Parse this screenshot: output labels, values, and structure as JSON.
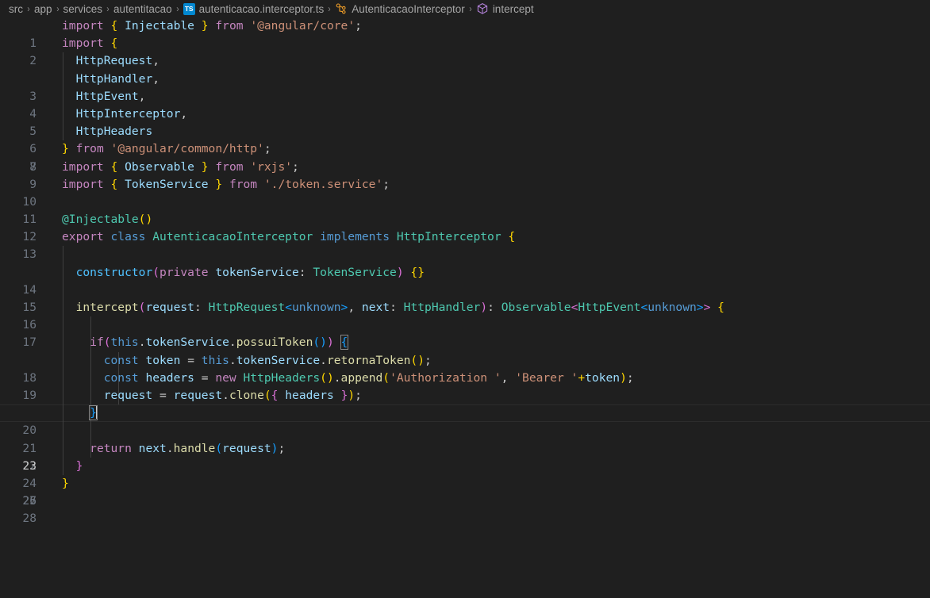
{
  "window": {
    "background": "#1f1f1f",
    "title": "autenticacao.interceptor.ts"
  },
  "breadcrumb": {
    "items": [
      {
        "label": "src",
        "icon": null,
        "sep": "›"
      },
      {
        "label": "app",
        "icon": null,
        "sep": "›"
      },
      {
        "label": "services",
        "icon": null,
        "sep": "›"
      },
      {
        "label": "autentitacao",
        "icon": null,
        "sep": "›"
      },
      {
        "label": "autenticacao.interceptor.ts",
        "icon": "ts-file-icon",
        "icon_text": "TS",
        "sep": "›"
      },
      {
        "label": "AutenticacaoInterceptor",
        "icon": "class-symbol-icon",
        "sep": "›"
      },
      {
        "label": "intercept",
        "icon": "method-symbol-icon",
        "sep": null
      }
    ],
    "separator": "›",
    "ts_badge_text": "TS",
    "ts_badge_color": "#0288d1",
    "class_icon_color": "#ee9d28",
    "method_icon_color": "#b180d7"
  },
  "colors": {
    "editor_background": "#1f1f1f",
    "line_number": "#6e7681",
    "active_line_number": "#cccccc",
    "keyword": "#c586c0",
    "keyword_blue": "#569cd6",
    "identifier": "#9cdcfe",
    "type": "#4ec9b0",
    "function": "#dcdcaa",
    "string": "#ce9178",
    "bracket_level1": "#ffd700",
    "bracket_level2": "#da70d6",
    "bracket_level3": "#179fff",
    "indent_guide": "#404040",
    "active_line_border": "#2c2c2c"
  },
  "editor": {
    "active_line": 23,
    "total_lines": 28,
    "language": "typescript",
    "lines": [
      {
        "n": 1,
        "text": "import { Injectable } from '@angular/core';"
      },
      {
        "n": 2,
        "text": "import {"
      },
      {
        "n": 3,
        "text": "  HttpRequest,"
      },
      {
        "n": 4,
        "text": "  HttpHandler,"
      },
      {
        "n": 5,
        "text": "  HttpEvent,"
      },
      {
        "n": 6,
        "text": "  HttpInterceptor,"
      },
      {
        "n": 7,
        "text": "  HttpHeaders"
      },
      {
        "n": 8,
        "text": "} from '@angular/common/http';"
      },
      {
        "n": 9,
        "text": "import { Observable } from 'rxjs';"
      },
      {
        "n": 10,
        "text": "import { TokenService } from './token.service';"
      },
      {
        "n": 11,
        "text": ""
      },
      {
        "n": 12,
        "text": "@Injectable()"
      },
      {
        "n": 13,
        "text": "export class AutenticacaoInterceptor implements HttpInterceptor {"
      },
      {
        "n": 14,
        "text": ""
      },
      {
        "n": 15,
        "text": "  constructor(private tokenService: TokenService) {}"
      },
      {
        "n": 16,
        "text": ""
      },
      {
        "n": 17,
        "text": "  intercept(request: HttpRequest<unknown>, next: HttpHandler): Observable<HttpEvent<unknown>> {"
      },
      {
        "n": 18,
        "text": ""
      },
      {
        "n": 19,
        "text": "    if(this.tokenService.possuiToken()) {"
      },
      {
        "n": 20,
        "text": "      const token = this.tokenService.retornaToken();"
      },
      {
        "n": 21,
        "text": "      const headers = new HttpHeaders().append('Authorization ', 'Bearer '+token);"
      },
      {
        "n": 22,
        "text": "      request = request.clone({ headers });"
      },
      {
        "n": 23,
        "text": "    }"
      },
      {
        "n": 24,
        "text": ""
      },
      {
        "n": 25,
        "text": "    return next.handle(request);"
      },
      {
        "n": 26,
        "text": "  }"
      },
      {
        "n": 27,
        "text": "}"
      },
      {
        "n": 28,
        "text": ""
      }
    ]
  }
}
